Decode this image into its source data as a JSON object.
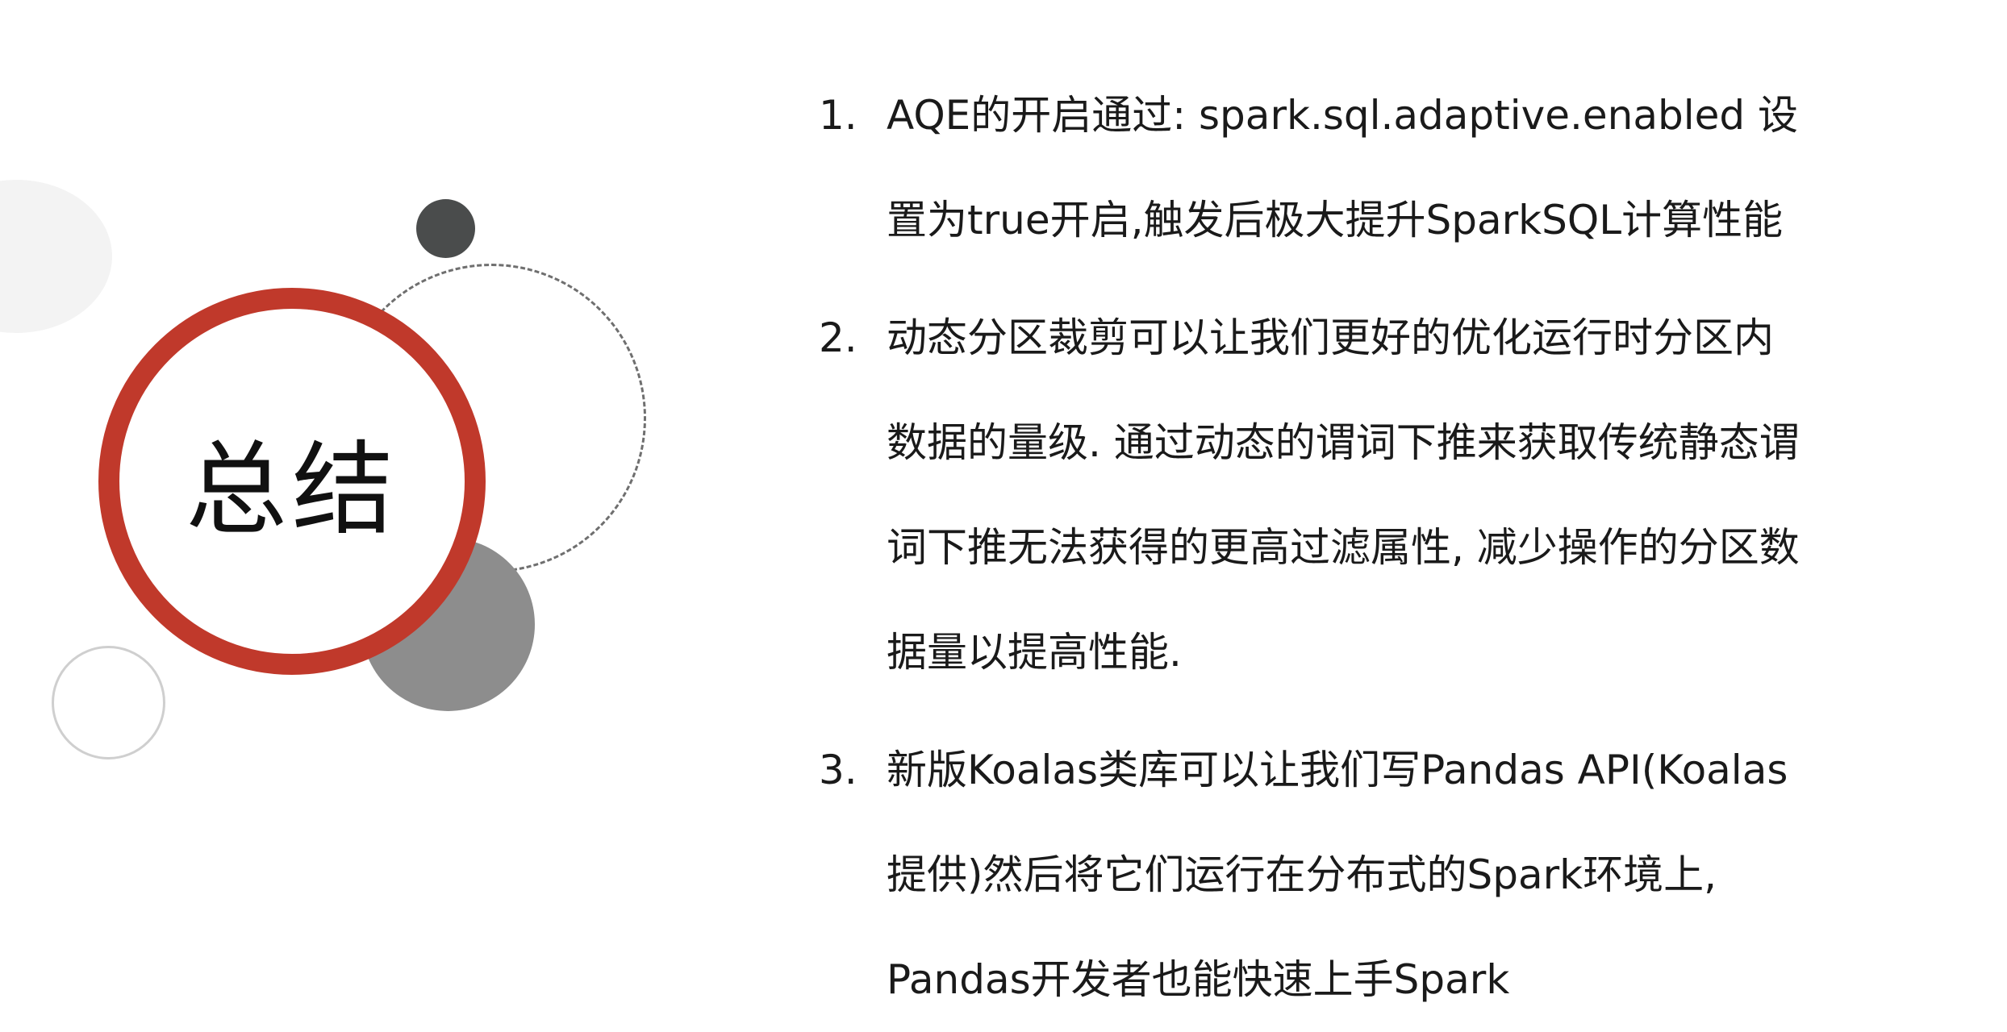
{
  "slide": {
    "title": "总结",
    "items": [
      {
        "number": "1.",
        "lines": [
          "AQE的开启通过: spark.sql.adaptive.enabled 设",
          "置为true开启,触发后极大提升SparkSQL计算性能"
        ]
      },
      {
        "number": "2.",
        "lines": [
          "动态分区裁剪可以让我们更好的优化运行时分区内",
          "数据的量级. 通过动态的谓词下推来获取传统静态谓",
          "词下推无法获得的更高过滤属性, 减少操作的分区数",
          "据量以提高性能."
        ]
      },
      {
        "number": "3.",
        "lines": [
          "新版Koalas类库可以让我们写Pandas API(Koalas",
          "提供)然后将它们运行在分布式的Spark环境上,",
          "Pandas开发者也能快速上手Spark"
        ]
      }
    ]
  },
  "colors": {
    "accent_red": "#c0392b",
    "dark_gray": "#4a4c4c",
    "mid_gray": "#8d8d8d",
    "pale_gray": "#f3f3f3"
  }
}
